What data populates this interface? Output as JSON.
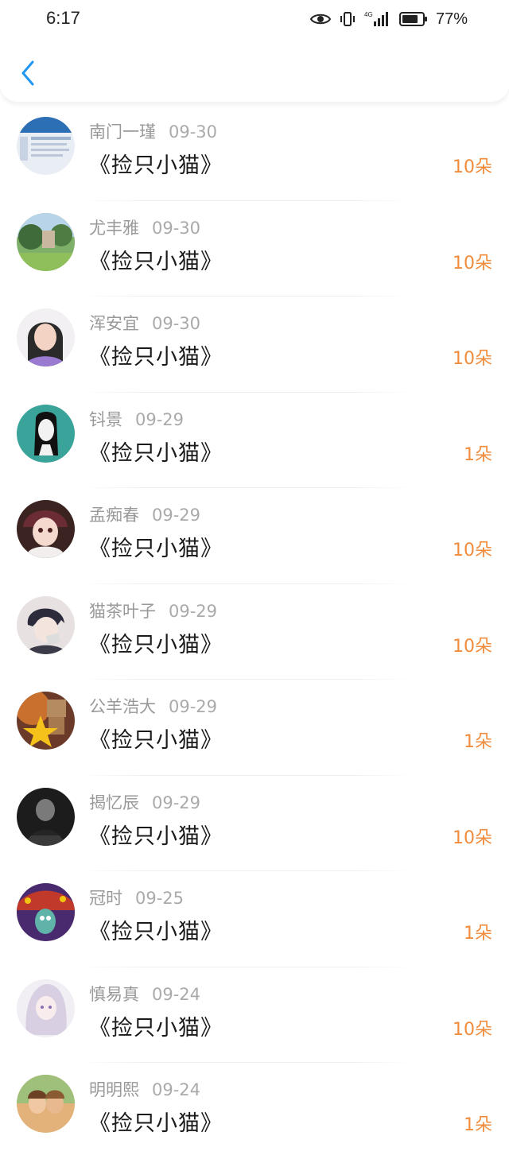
{
  "status_bar": {
    "time": "6:17",
    "battery_percent": "77%",
    "network": "4G"
  },
  "nav": {
    "back_icon": "chevron-left-icon"
  },
  "colors": {
    "accent_amount": "#f08c3c",
    "back_icon": "#2196f3"
  },
  "items": [
    {
      "name": "南门一瑾",
      "date": "09-30",
      "title": "《捡只小猫》",
      "amount": "10朵"
    },
    {
      "name": "尤丰雅",
      "date": "09-30",
      "title": "《捡只小猫》",
      "amount": "10朵"
    },
    {
      "name": "浑安宜",
      "date": "09-30",
      "title": "《捡只小猫》",
      "amount": "10朵"
    },
    {
      "name": "钭景",
      "date": "09-29",
      "title": "《捡只小猫》",
      "amount": "1朵"
    },
    {
      "name": "孟痴春",
      "date": "09-29",
      "title": "《捡只小猫》",
      "amount": "10朵"
    },
    {
      "name": "猫茶叶子",
      "date": "09-29",
      "title": "《捡只小猫》",
      "amount": "10朵"
    },
    {
      "name": "公羊浩大",
      "date": "09-29",
      "title": "《捡只小猫》",
      "amount": "1朵"
    },
    {
      "name": "揭忆辰",
      "date": "09-29",
      "title": "《捡只小猫》",
      "amount": "10朵"
    },
    {
      "name": "冠时",
      "date": "09-25",
      "title": "《捡只小猫》",
      "amount": "1朵"
    },
    {
      "name": "慎易真",
      "date": "09-24",
      "title": "《捡只小猫》",
      "amount": "10朵"
    },
    {
      "name": "明明熙",
      "date": "09-24",
      "title": "《捡只小猫》",
      "amount": "1朵"
    }
  ]
}
